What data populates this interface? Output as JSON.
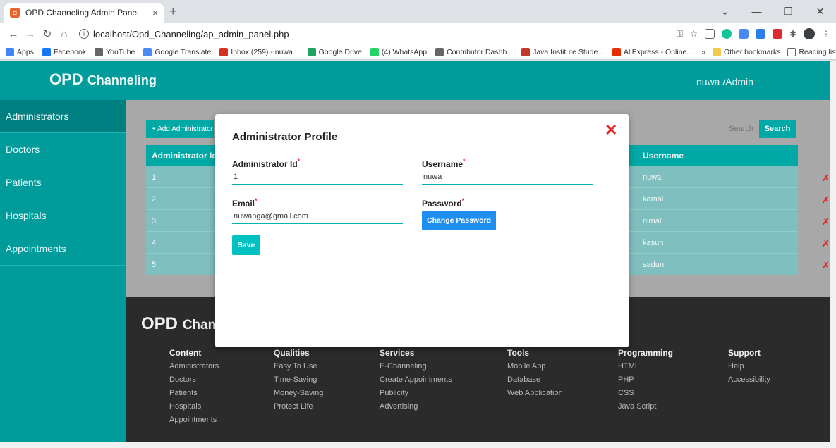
{
  "browser": {
    "tab_title": "OPD Channeling Admin Panel",
    "tab_close": "×",
    "new_tab": "+",
    "url": "localhost/Opd_Channeling/ap_admin_panel.php",
    "bookmarks": [
      {
        "label": "Apps",
        "color": "#4285f4"
      },
      {
        "label": "Facebook",
        "color": "#1877f2"
      },
      {
        "label": "YouTube",
        "color": "#666666"
      },
      {
        "label": "Google Translate",
        "color": "#4a8af4"
      },
      {
        "label": "Inbox (259) - nuwa...",
        "color": "#d93025"
      },
      {
        "label": "Google Drive",
        "color": "#1fa463"
      },
      {
        "label": "(4) WhatsApp",
        "color": "#25d366"
      },
      {
        "label": "Contributor Dashb...",
        "color": "#666666"
      },
      {
        "label": "Java Institute Stude...",
        "color": "#c0392b"
      },
      {
        "label": "AliExpress - Online...",
        "color": "#e62e04"
      }
    ],
    "bookmarks_more": "»",
    "other_bookmarks": "Other bookmarks",
    "reading_list": "Reading list"
  },
  "header": {
    "brand_main": "OPD",
    "brand_sub": "Channeling",
    "user": "nuwa /Admin"
  },
  "sidebar": {
    "items": [
      {
        "label": "Administrators"
      },
      {
        "label": "Doctors"
      },
      {
        "label": "Patients"
      },
      {
        "label": "Hospitals"
      },
      {
        "label": "Appointments"
      }
    ]
  },
  "content": {
    "add_button": "+ Add Administrator",
    "search_placeholder": "Search",
    "search_button": "Search",
    "columns": [
      "Administrator Id",
      "Username"
    ],
    "rows": [
      {
        "id": "1",
        "username": "nuwa"
      },
      {
        "id": "2",
        "username": "kamal"
      },
      {
        "id": "3",
        "username": "nimal"
      },
      {
        "id": "4",
        "username": "kasun"
      },
      {
        "id": "5",
        "username": "sadun"
      }
    ],
    "delete_glyph": "✗"
  },
  "footer": {
    "brand_main": "OPD",
    "brand_sub": "Channeling",
    "columns": [
      {
        "title": "Content",
        "items": [
          "Administrators",
          "Doctors",
          "Patients",
          "Hospitals",
          "Appointments"
        ]
      },
      {
        "title": "Qualities",
        "items": [
          "Easy To Use",
          "Time-Saving",
          "Money-Saving",
          "Protect Life"
        ]
      },
      {
        "title": "Services",
        "items": [
          "E-Channeling",
          "Create Appointments",
          "Publicity",
          "Advertising"
        ]
      },
      {
        "title": "Tools",
        "items": [
          "Mobile App",
          "Database",
          "Web Application"
        ]
      },
      {
        "title": "Programming",
        "items": [
          "HTML",
          "PHP",
          "CSS",
          "Java Script"
        ]
      },
      {
        "title": "Support",
        "items": [
          "Help",
          "Accessibility"
        ]
      }
    ]
  },
  "modal": {
    "title": "Administrator Profile",
    "close": "✕",
    "admin_id_label": "Administrator Id",
    "admin_id_value": "1",
    "username_label": "Username",
    "username_value": "nuwa",
    "email_label": "Email",
    "email_value": "nuwanga@gmail.com",
    "password_label": "Password",
    "change_password": "Change Password",
    "save": "Save",
    "required_mark": "*"
  },
  "colors": {
    "brand_teal": "#009b9b",
    "button_teal": "#00a8a6",
    "danger": "#e52525",
    "primary_blue": "#1e8ff0"
  }
}
